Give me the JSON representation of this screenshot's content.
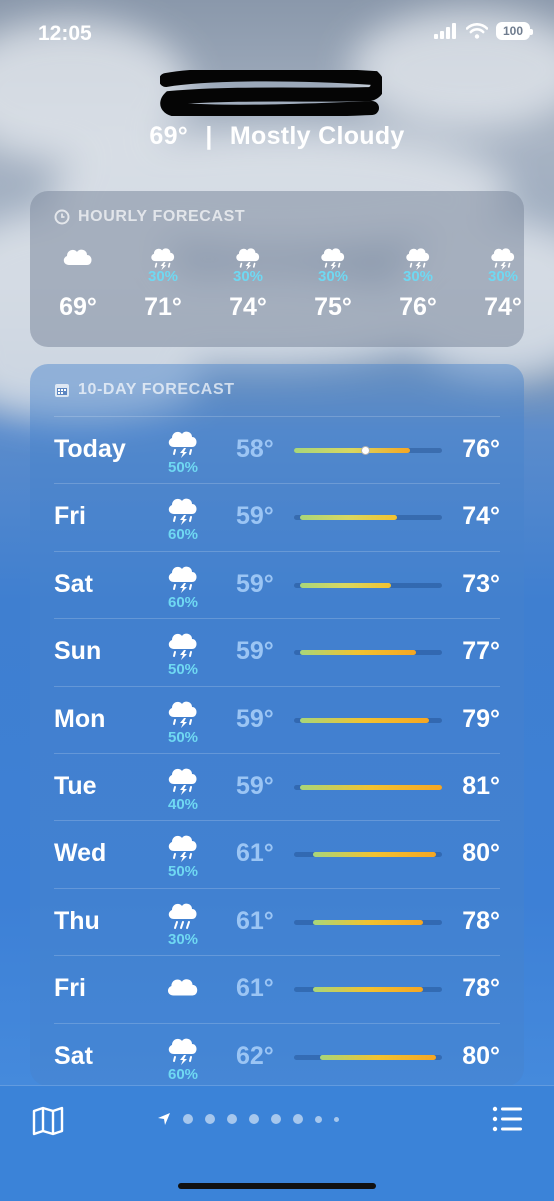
{
  "status_bar": {
    "time": "12:05",
    "battery": "100"
  },
  "current": {
    "temperature": "69°",
    "separator": "|",
    "condition": "Mostly Cloudy"
  },
  "hourly": {
    "header": "HOURLY FORECAST",
    "items": [
      {
        "icon": "cloud-icon",
        "precip": "",
        "temp": "69°"
      },
      {
        "icon": "thunderstorm-icon",
        "precip": "30%",
        "temp": "71°"
      },
      {
        "icon": "thunderstorm-icon",
        "precip": "30%",
        "temp": "74°"
      },
      {
        "icon": "thunderstorm-icon",
        "precip": "30%",
        "temp": "75°"
      },
      {
        "icon": "thunderstorm-icon",
        "precip": "30%",
        "temp": "76°"
      },
      {
        "icon": "thunderstorm-icon",
        "precip": "30%",
        "temp": "74°"
      }
    ]
  },
  "daily": {
    "header": "10-DAY FORECAST",
    "range_min": 58,
    "range_max": 81,
    "current_temp": 69,
    "days": [
      {
        "day": "Today",
        "icon": "thunderstorm-icon",
        "precip": "50%",
        "low": "58°",
        "high": "76°",
        "low_val": 58,
        "high_val": 76,
        "current": true
      },
      {
        "day": "Fri",
        "icon": "thunderstorm-icon",
        "precip": "60%",
        "low": "59°",
        "high": "74°",
        "low_val": 59,
        "high_val": 74
      },
      {
        "day": "Sat",
        "icon": "thunderstorm-icon",
        "precip": "60%",
        "low": "59°",
        "high": "73°",
        "low_val": 59,
        "high_val": 73
      },
      {
        "day": "Sun",
        "icon": "thunderstorm-icon",
        "precip": "50%",
        "low": "59°",
        "high": "77°",
        "low_val": 59,
        "high_val": 77
      },
      {
        "day": "Mon",
        "icon": "thunderstorm-icon",
        "precip": "50%",
        "low": "59°",
        "high": "79°",
        "low_val": 59,
        "high_val": 79
      },
      {
        "day": "Tue",
        "icon": "thunderstorm-icon",
        "precip": "40%",
        "low": "59°",
        "high": "81°",
        "low_val": 59,
        "high_val": 81
      },
      {
        "day": "Wed",
        "icon": "thunderstorm-icon",
        "precip": "50%",
        "low": "61°",
        "high": "80°",
        "low_val": 61,
        "high_val": 80
      },
      {
        "day": "Thu",
        "icon": "rain-icon",
        "precip": "30%",
        "low": "61°",
        "high": "78°",
        "low_val": 61,
        "high_val": 78
      },
      {
        "day": "Fri",
        "icon": "cloud-icon",
        "precip": "",
        "low": "61°",
        "high": "78°",
        "low_val": 61,
        "high_val": 78
      },
      {
        "day": "Sat",
        "icon": "thunderstorm-icon",
        "precip": "60%",
        "low": "62°",
        "high": "80°",
        "low_val": 62,
        "high_val": 80
      }
    ]
  },
  "toolbar": {
    "map_icon": "map-icon",
    "location_icon": "location-arrow-icon",
    "list_icon": "list-icon",
    "page_count": 8
  },
  "colors": {
    "precip": "#6fd8f2",
    "bar_cool": "#a8d67a",
    "bar_warm": "#f5a623"
  }
}
